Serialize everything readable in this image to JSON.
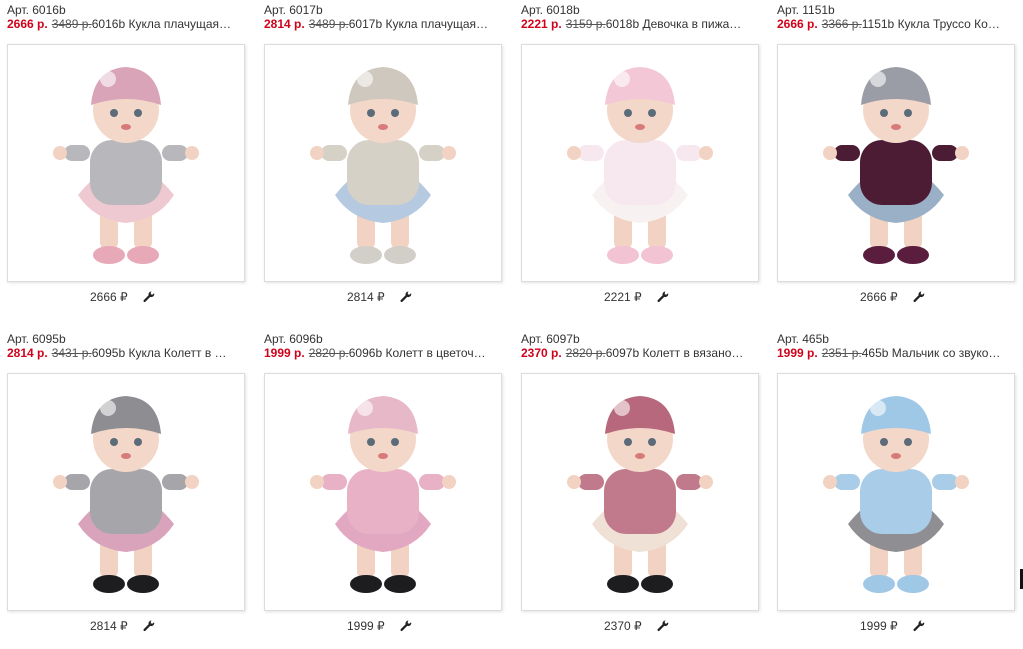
{
  "currency_symbol": "₽",
  "products": [
    {
      "article": "Арт. 6016b",
      "price": "2666 р.",
      "old_price": "3489 р.",
      "name": "6016b Кукла плачущая…",
      "bottom_price": "2666",
      "colors": {
        "hat": "#d9a3b8",
        "top": "#b8b8bc",
        "dress": "#efc9d2",
        "shoe": "#e7a9b8"
      }
    },
    {
      "article": "Арт. 6017b",
      "price": "2814 р.",
      "old_price": "3489 р.",
      "name": "6017b Кукла плачущая…",
      "bottom_price": "2814",
      "colors": {
        "hat": "#cfc8bf",
        "top": "#d6d1c6",
        "dress": "#b5c9e0",
        "shoe": "#d2cfc8"
      }
    },
    {
      "article": "Арт. 6018b",
      "price": "2221 р.",
      "old_price": "3159 р.",
      "name": "6018b Девочка в пижа…",
      "bottom_price": "2221",
      "colors": {
        "hat": "#f3c7d6",
        "top": "#f6e8ee",
        "dress": "#f8f1f1",
        "shoe": "#f2c3d2"
      }
    },
    {
      "article": "Арт. 1151b",
      "price": "2666 р.",
      "old_price": "3366 р.",
      "name": "1151b Кукла Труссо Ко…",
      "bottom_price": "2666",
      "colors": {
        "hat": "#9a9da5",
        "top": "#4b1c33",
        "dress": "#9ab0c7",
        "shoe": "#5b1d3d"
      }
    },
    {
      "article": "Арт. 6095b",
      "price": "2814 р.",
      "old_price": "3431 р.",
      "name": "6095b Кукла Колетт в …",
      "bottom_price": "2814",
      "colors": {
        "hat": "#8e8e92",
        "top": "#a6a6aa",
        "dress": "#d9a3bb",
        "shoe": "#1d1d1f"
      }
    },
    {
      "article": "Арт. 6096b",
      "price": "1999 р.",
      "old_price": "2820 р.",
      "name": "6096b Колетт в цветоч…",
      "bottom_price": "1999",
      "colors": {
        "hat": "#e7b8c8",
        "top": "#e8b1c6",
        "dress": "#e3a8c1",
        "shoe": "#1d1d1f"
      }
    },
    {
      "article": "Арт. 6097b",
      "price": "2370 р.",
      "old_price": "2820 р.",
      "name": "6097b Колетт в вязано…",
      "bottom_price": "2370",
      "colors": {
        "hat": "#b8687c",
        "top": "#c07a8c",
        "dress": "#efe1d6",
        "shoe": "#1d1d1f"
      }
    },
    {
      "article": "Арт. 465b",
      "price": "1999 р.",
      "old_price": "2351 р.",
      "name": "465b Мальчик со звуко…",
      "bottom_price": "1999",
      "colors": {
        "hat": "#9fc7e6",
        "top": "#a9cde8",
        "dress": "#8f8f93",
        "shoe": "#9fc7e6"
      }
    }
  ]
}
